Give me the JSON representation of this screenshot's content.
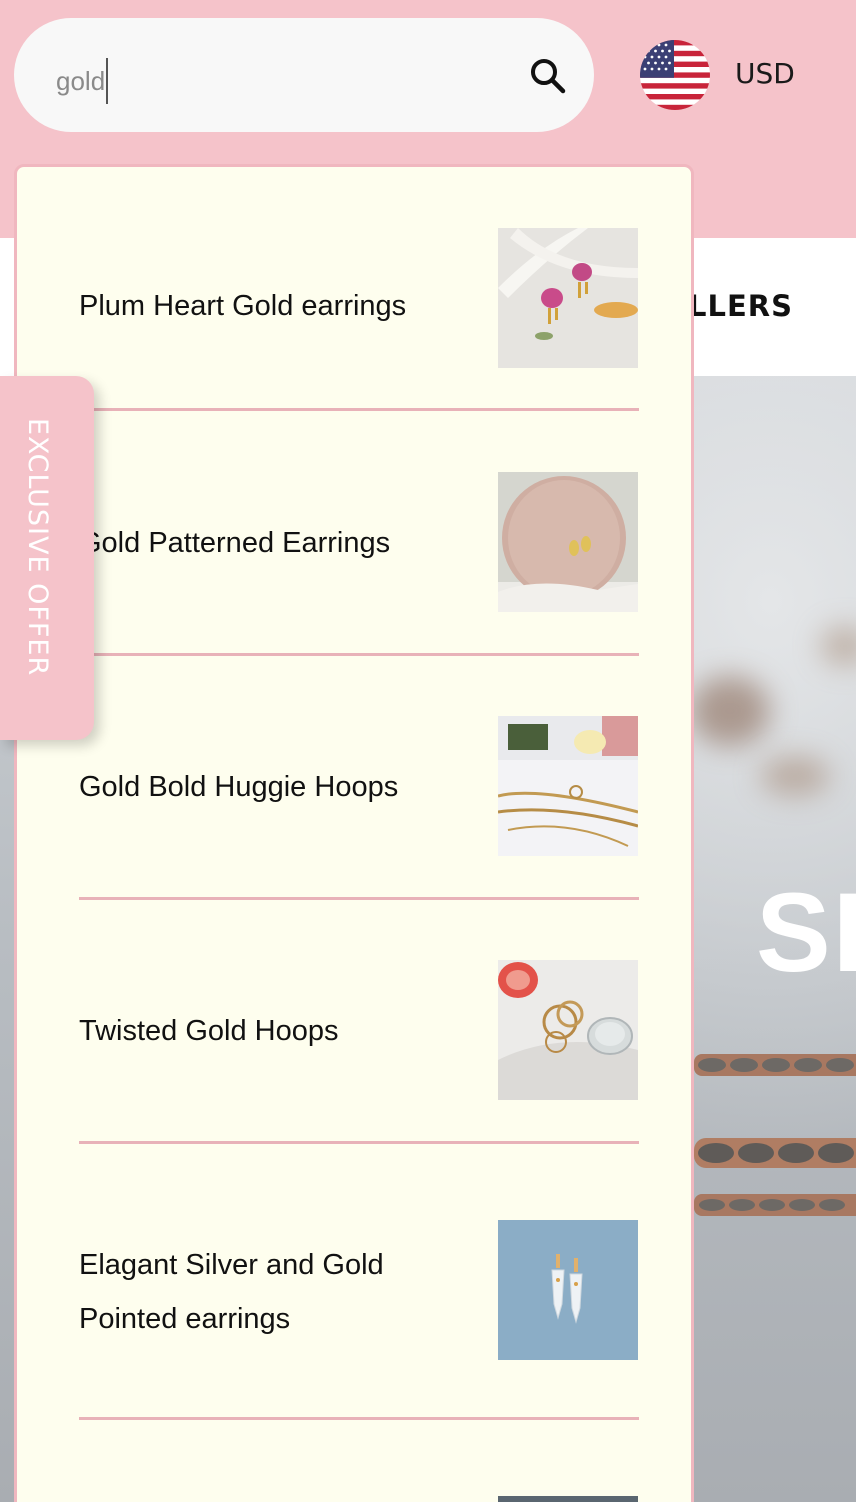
{
  "search": {
    "value": "gold"
  },
  "currency": {
    "label": "USD",
    "flag_icon": "us-flag-icon"
  },
  "nav": {
    "partial_label": "LLERS"
  },
  "hero": {
    "partial_text": "SH"
  },
  "offer_tab": {
    "label": "EXCLUSIVE OFFER"
  },
  "results": [
    {
      "title": "Plum Heart Gold earrings",
      "thumb": "pink heart earrings on white fabric"
    },
    {
      "title": "Gold Patterned Earrings",
      "thumb": "gold stud earrings on pink stone disc"
    },
    {
      "title": "Gold Bold Huggie Hoops",
      "thumb": "gold chains and hoops with flower"
    },
    {
      "title": "Twisted Gold Hoops",
      "thumb": "gold hoops with glass and grapefruit"
    },
    {
      "title": "Elagant Silver and Gold\nPointed earrings",
      "title_line1": "Elagant Silver and Gold",
      "title_line2": "Pointed earrings",
      "thumb": "drop earrings on blue background"
    }
  ],
  "colors": {
    "header_pink": "#f5c3ca",
    "dropdown_bg": "#fefeee",
    "divider": "#e8b2b8"
  }
}
